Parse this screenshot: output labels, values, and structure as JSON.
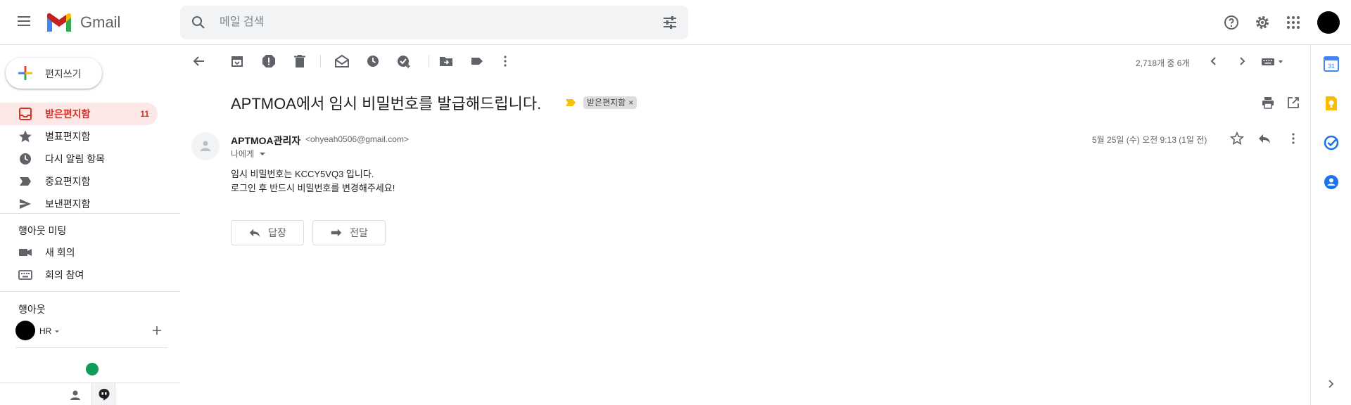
{
  "header": {
    "app_name": "Gmail",
    "search_placeholder": "메일 검색"
  },
  "sidebar": {
    "compose_label": "편지쓰기",
    "items": [
      {
        "label": "받은편지함",
        "count": "11",
        "icon": "inbox-icon",
        "active": true
      },
      {
        "label": "별표편지함",
        "icon": "star-icon"
      },
      {
        "label": "다시 알림 항목",
        "icon": "clock-icon"
      },
      {
        "label": "중요편지함",
        "icon": "important-icon"
      },
      {
        "label": "보낸편지함",
        "icon": "send-icon"
      }
    ],
    "meet_title": "행아웃 미팅",
    "meet_items": [
      {
        "label": "새 회의",
        "icon": "video-icon"
      },
      {
        "label": "회의 참여",
        "icon": "keyboard-icon"
      }
    ],
    "hangouts_title": "행아웃",
    "hangouts_user": "HR"
  },
  "toolbar": {
    "pager": "2,718개 중 6개"
  },
  "message": {
    "subject": "APTMOA에서 임시 비밀번호를 발급해드립니다.",
    "label_chip": "받은편지함",
    "label_chip_close": "×",
    "sender_name": "APTMOA관리자",
    "sender_email": "<ohyeah0506@gmail.com>",
    "to": "나에게",
    "date": "5월 25일 (수) 오전 9:13 (1일 전)",
    "body": [
      "임시 비밀번호는 KCCY5VQ3 입니다.",
      "로그인 후 반드시 비밀번호를 변경해주세요!"
    ],
    "reply_label": "답장",
    "forward_label": "전달"
  },
  "colors": {
    "accent_red": "#d93025",
    "active_bg": "#fce8e6",
    "hangouts_green": "#0f9d58"
  }
}
